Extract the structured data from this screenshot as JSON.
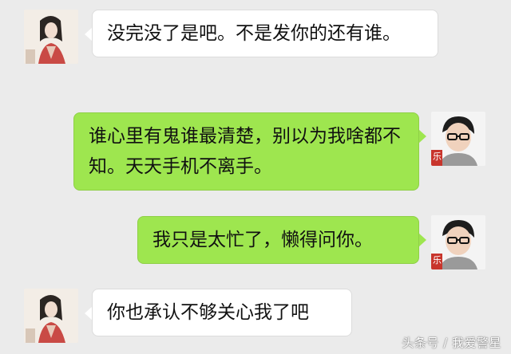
{
  "messages": [
    {
      "side": "left",
      "sender": "female-avatar",
      "text": "没完没了是吧。不是发你的还有谁。"
    },
    {
      "side": "right",
      "sender": "male-avatar",
      "text": "谁心里有鬼谁最清楚，别以为我啥都不知。天天手机不离手。"
    },
    {
      "side": "right",
      "sender": "male-avatar",
      "text": "我只是太忙了，懒得问你。"
    },
    {
      "side": "left",
      "sender": "female-avatar",
      "text": "你也承认不够关心我了吧"
    }
  ],
  "avatar_caption": "乐",
  "watermark": "头条号 / 我爱警星",
  "colors": {
    "background": "#ebebeb",
    "right_bubble": "#9ee64f",
    "left_bubble": "#ffffff"
  }
}
